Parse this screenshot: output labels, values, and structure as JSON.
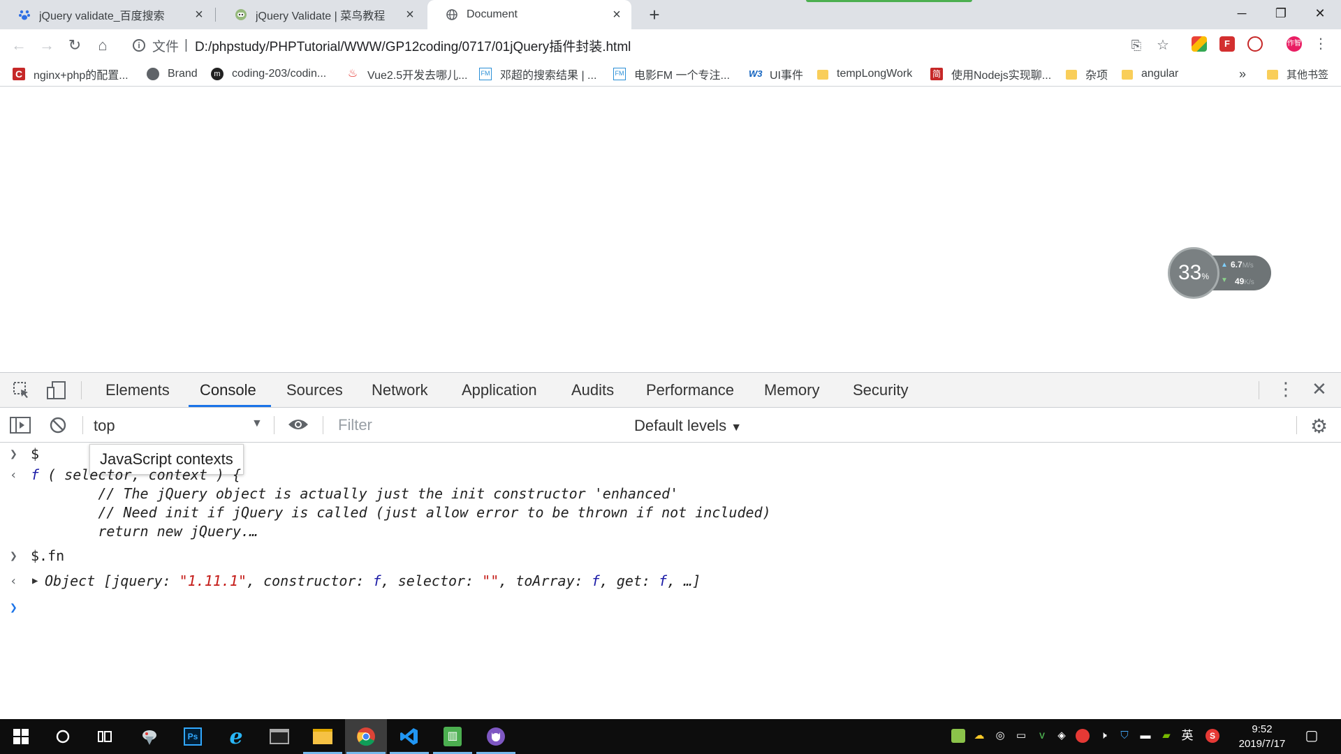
{
  "browser": {
    "tabs": [
      {
        "title": "jQuery validate_百度搜索",
        "icon": "baidu-paw-icon"
      },
      {
        "title": "jQuery Validate | 菜鸟教程",
        "icon": "runoob-icon"
      },
      {
        "title": "Document",
        "icon": "globe-icon",
        "active": true
      }
    ],
    "omnibox": {
      "scheme_label": "文件",
      "separator": "|",
      "url": "D:/phpstudy/PHPTutorial/WWW/GP12coding/0717/01jQuery插件封装.html"
    },
    "bookmarks": [
      {
        "label": "nginx+php的配置...",
        "icon": "red-c-icon"
      },
      {
        "label": "Brand",
        "icon": "globe-icon"
      },
      {
        "label": "coding-203/codin...",
        "icon": "coding-icon"
      },
      {
        "label": "Vue2.5开发去哪儿...",
        "icon": "flame-icon"
      },
      {
        "label": "邓超的搜索结果 | ...",
        "icon": "fm-icon"
      },
      {
        "label": "电影FM 一个专注...",
        "icon": "fm-icon"
      },
      {
        "label": "UI事件",
        "icon": "w3-icon"
      },
      {
        "label": "tempLongWork",
        "icon": "folder-icon"
      },
      {
        "label": "使用Nodejs实现聊...",
        "icon": "jian-icon"
      },
      {
        "label": "杂项",
        "icon": "folder-icon"
      },
      {
        "label": "angular",
        "icon": "folder-icon"
      }
    ],
    "bookmarks_overflow": "»",
    "other_bookmarks": "其他书签",
    "profile_label": "作智"
  },
  "speed_widget": {
    "percent": "33",
    "percent_unit": "%",
    "up_value": "6.7",
    "up_unit": "M/s",
    "down_value": "49",
    "down_unit": "K/s"
  },
  "devtools": {
    "tabs": [
      "Elements",
      "Console",
      "Sources",
      "Network",
      "Application",
      "Audits",
      "Performance",
      "Memory",
      "Security"
    ],
    "active_tab": "Console",
    "context": "top",
    "filter_placeholder": "Filter",
    "levels": "Default levels",
    "tooltip": "JavaScript contexts",
    "console": {
      "input1": "$",
      "out1_f": "f",
      "out1_sig": " ( selector, context ) {",
      "out1_line2": "        // The jQuery object is actually just the init constructor 'enhanced'",
      "out1_line3": "        // Need init if jQuery is called (just allow error to be thrown if not included)",
      "out1_line4": "        return new jQuery.…",
      "input2": "$.fn",
      "out2_prefix": "Object [jquery: ",
      "out2_version": "\"1.11.1\"",
      "out2_mid1": ", constructor: ",
      "out2_f1": "f",
      "out2_mid2": ", selector: ",
      "out2_sel": "\"\"",
      "out2_mid3": ", toArray: ",
      "out2_f2": "f",
      "out2_mid4": ", get: ",
      "out2_f3": "f",
      "out2_suffix": ", …]"
    }
  },
  "taskbar": {
    "time": "9:52",
    "date": "2019/7/17",
    "ime": "英"
  },
  "colors": {
    "tab_strip": "#dee1e6",
    "devtools_toolbar": "#f3f3f3",
    "accent_blue": "#1a73e8",
    "string_red": "#c41a16",
    "taskbar": "#0d0d0d"
  }
}
